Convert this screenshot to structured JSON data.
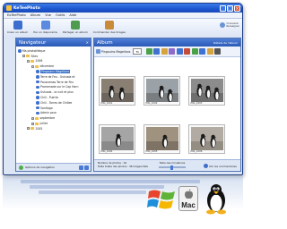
{
  "window": {
    "title": "KeTeePhoto"
  },
  "menu": [
    "EoTeePhoto",
    "Album",
    "Vue",
    "Outils",
    "Aide"
  ],
  "toolbar": {
    "items": [
      {
        "label": "Créer un album",
        "color": "#3d6ecf"
      },
      {
        "label": "Par un diaporama",
        "color": "#5b8ae0"
      },
      {
        "label": "Partager un album",
        "color": "#4f9c50"
      },
      {
        "label": "Commander des tirages",
        "color": "#c98a3a"
      }
    ],
    "right_lines": [
      "Connexion",
      "Renseigner"
    ]
  },
  "navigator": {
    "title": "Navigateur",
    "tree": [
      {
        "label": "Ma photothèque",
        "level": 0,
        "kind": "dot"
      },
      {
        "label": "Sites",
        "level": 1,
        "kind": "folder",
        "exp": "-"
      },
      {
        "label": "2006",
        "level": 2,
        "kind": "folder",
        "exp": "-"
      },
      {
        "label": "décembre",
        "level": 3,
        "kind": "folder",
        "exp": "-"
      },
      {
        "label": "Pingouins Magellans",
        "level": 4,
        "kind": "dot",
        "selected": true
      },
      {
        "label": "Terre de Feu - Ushuaia et",
        "level": 4,
        "kind": "dot"
      },
      {
        "label": "Panoramas Terre de Feu",
        "level": 4,
        "kind": "dot"
      },
      {
        "label": "Promenade sur le Cap Horn",
        "level": 4,
        "kind": "dot"
      },
      {
        "label": "Ushuaia - la nuit et plus",
        "level": 4,
        "kind": "dot"
      },
      {
        "label": "Chili - Puerto",
        "level": 4,
        "kind": "dot"
      },
      {
        "label": "Chili - Torres de Chiliee",
        "level": 4,
        "kind": "dot"
      },
      {
        "label": "Santiago",
        "level": 4,
        "kind": "dot"
      },
      {
        "label": "Admin pour",
        "level": 4,
        "kind": "dot"
      },
      {
        "label": "septembre",
        "level": 3,
        "kind": "folder",
        "exp": "+"
      },
      {
        "label": "juillet",
        "level": 3,
        "kind": "folder",
        "exp": "+"
      },
      {
        "label": "2005",
        "level": 2,
        "kind": "folder",
        "exp": "+"
      }
    ],
    "footer_label": "Options de navigation"
  },
  "album": {
    "tab_title": "Album",
    "header_right": "Détails de l'album",
    "name": "Pingouins Magellans",
    "button": "Tri",
    "tool_colors": [
      "#4aa14a",
      "#3f72d2",
      "#d5a43c",
      "#8c6bc9",
      "#3f72d2",
      "#c74b3a",
      "#4aa14a",
      "#3f72d2",
      "#d5a43c",
      "#555555"
    ],
    "photos": [
      {
        "caption": "IMG_1001"
      },
      {
        "caption": "IMG_1002"
      },
      {
        "caption": "IMG_1003"
      },
      {
        "caption": "IMG_1004"
      },
      {
        "caption": "IMG_1005"
      },
      {
        "caption": "IMG_1006"
      }
    ],
    "footer": {
      "count_line": "Nombre de photos : 16",
      "size_line": "Taille totale des photos : 48 mégaoctets",
      "mid_label": "Taille des miniatures",
      "right_label": "Voir les commentaires"
    }
  },
  "os": {
    "mac_label": "Mac"
  }
}
